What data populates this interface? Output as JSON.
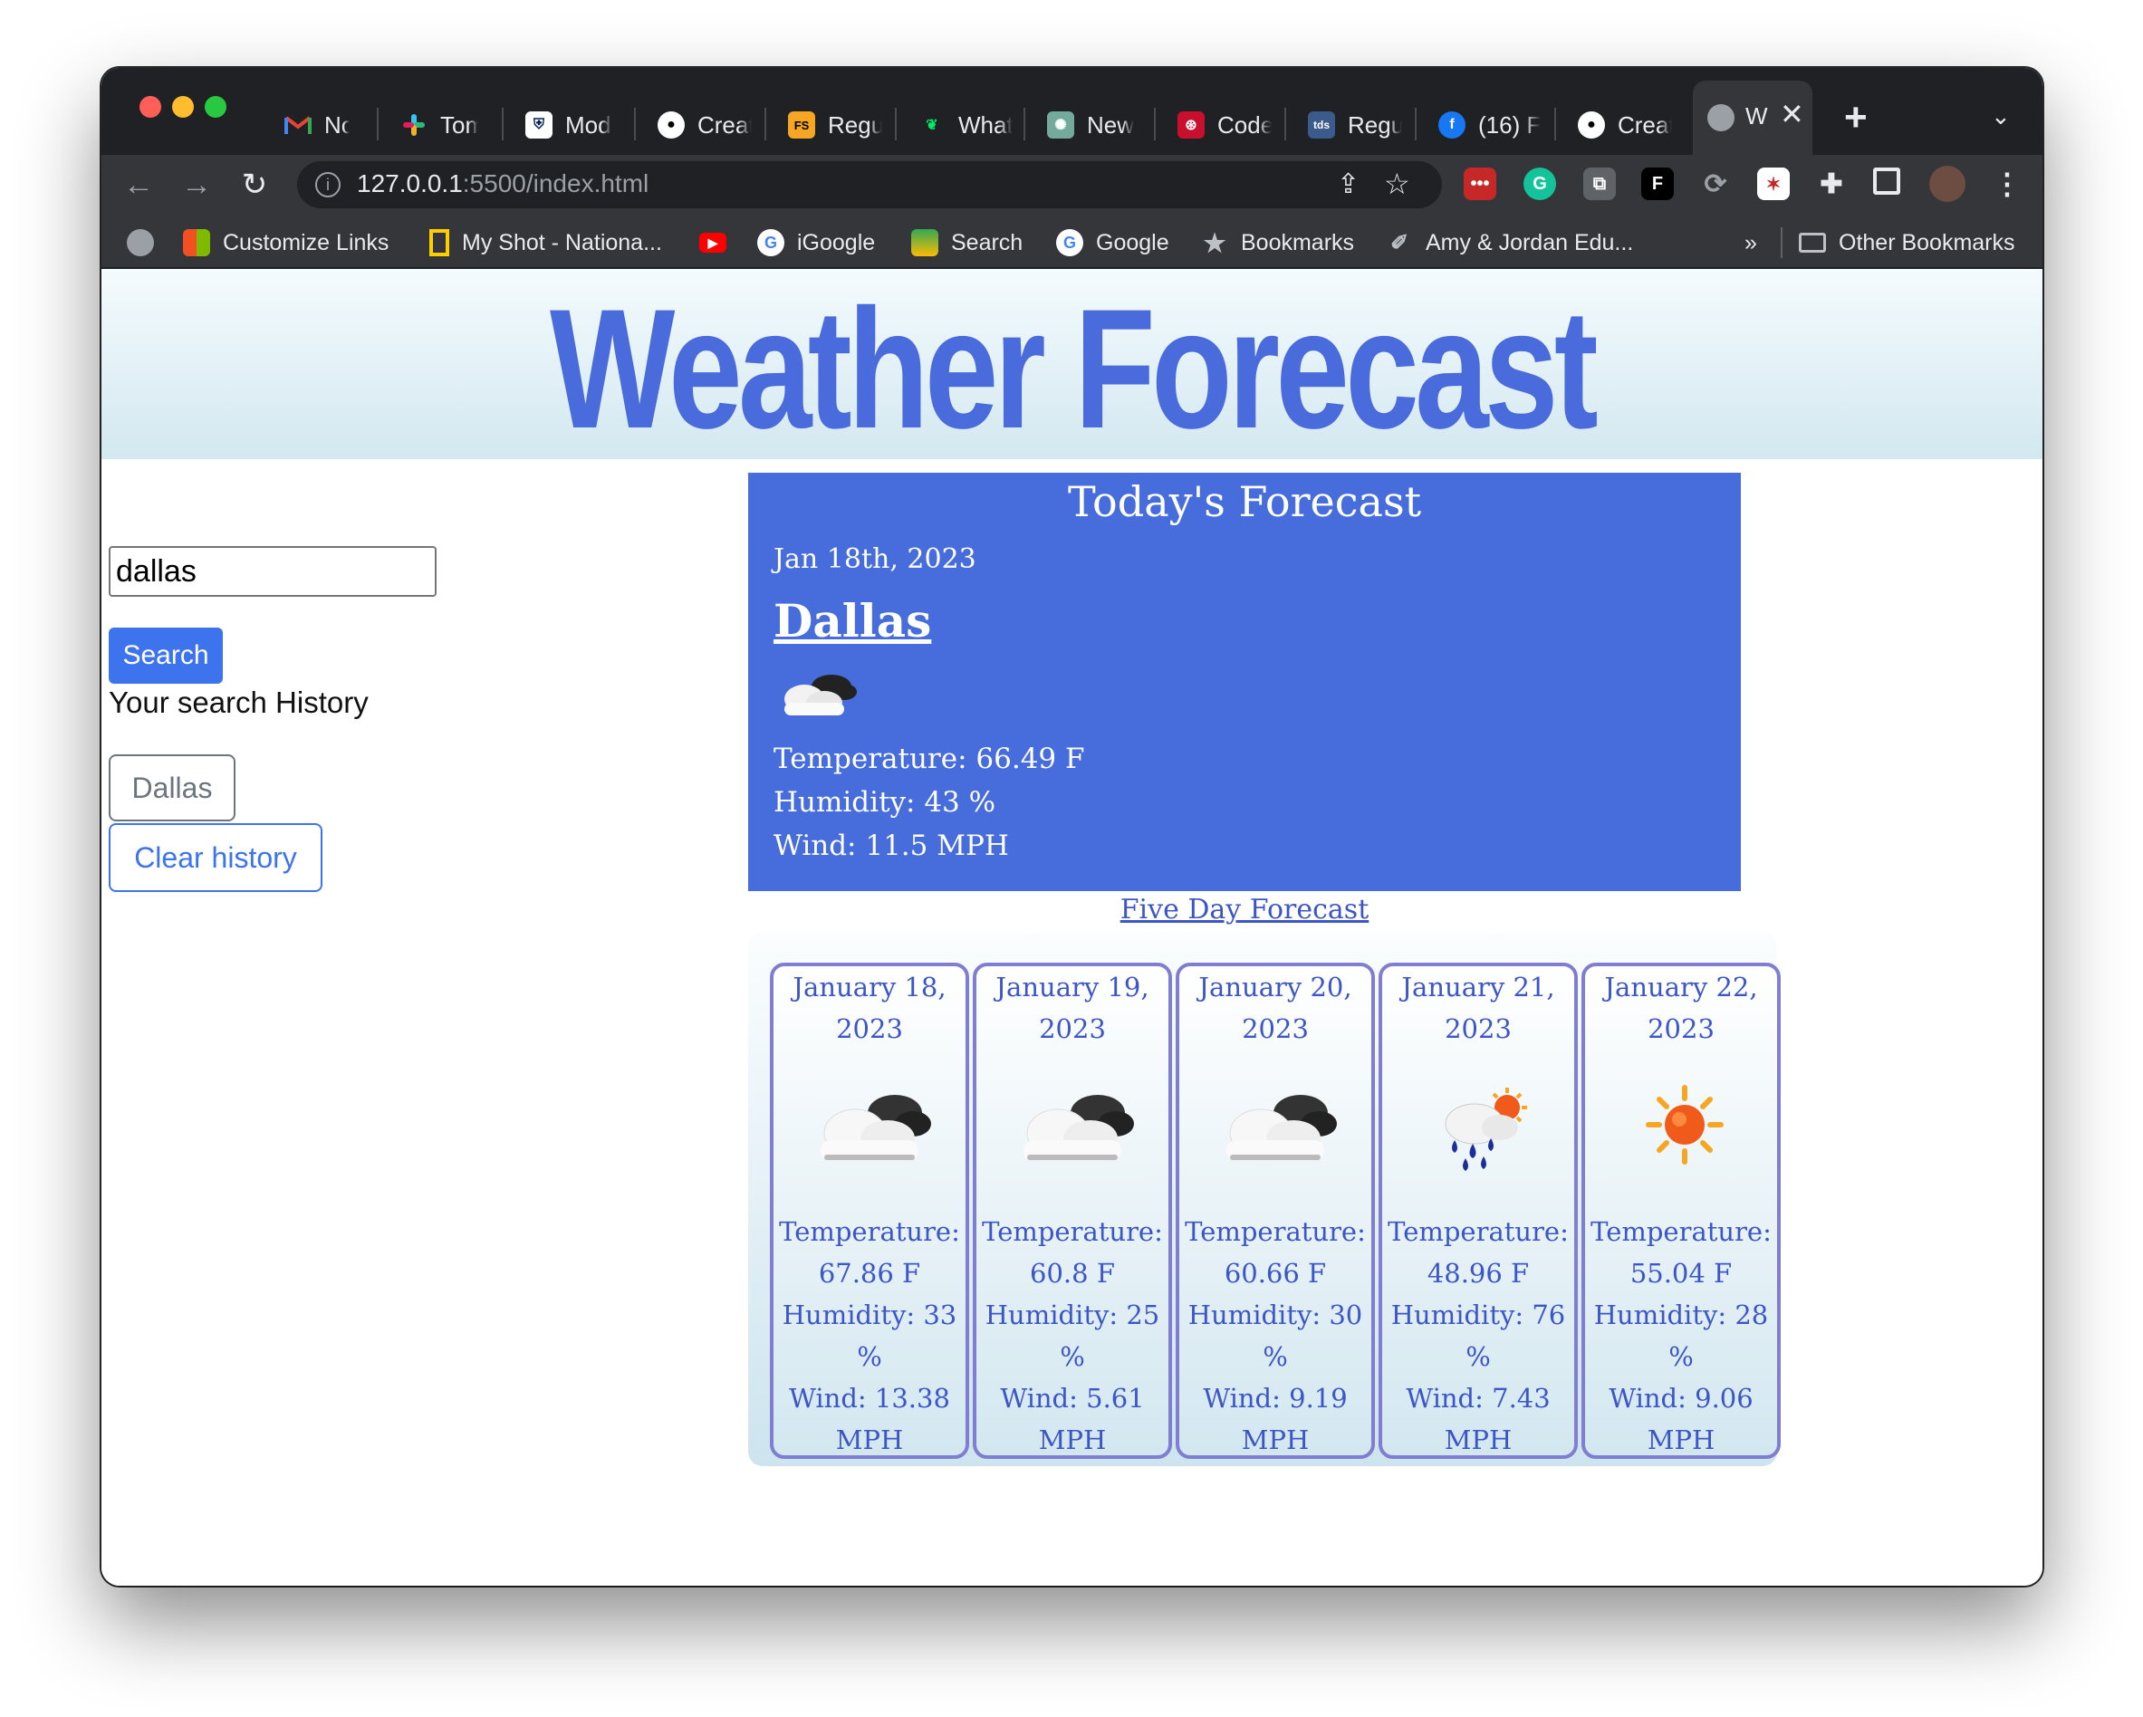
{
  "browser": {
    "tabs": [
      {
        "title": "Notifi",
        "icon": "gmail-icon"
      },
      {
        "title": "Tom V",
        "icon": "slack-icon"
      },
      {
        "title": "Modu",
        "icon": "penn-icon"
      },
      {
        "title": "Creat",
        "icon": "github-icon"
      },
      {
        "title": "Regul",
        "icon": "fs-icon",
        "icon_text": "FS"
      },
      {
        "title": "What",
        "icon": "mongodb-icon"
      },
      {
        "title": "New",
        "icon": "chatgpt-icon"
      },
      {
        "title": "Code",
        "icon": "codesignal-icon"
      },
      {
        "title": "Regul",
        "icon": "tds-icon",
        "icon_text": "tds"
      },
      {
        "title": "(16) F",
        "icon": "facebook-icon"
      },
      {
        "title": "Creat",
        "icon": "github-icon"
      }
    ],
    "active_tab": {
      "title": "W",
      "icon": "globe-icon"
    },
    "url_host": "127.0.0.1",
    "url_rest": ":5500/index.html",
    "bookmarks": [
      {
        "label": "",
        "icon": "globe-icon"
      },
      {
        "label": "Customize Links",
        "icon": "microsoft-icon"
      },
      {
        "label": "My Shot - Nationa...",
        "icon": "natgeo-icon"
      },
      {
        "label": "",
        "icon": "youtube-icon"
      },
      {
        "label": "iGoogle",
        "icon": "google-icon"
      },
      {
        "label": "Search",
        "icon": "search-app-icon"
      },
      {
        "label": "Google",
        "icon": "google-icon"
      },
      {
        "label": "Bookmarks",
        "icon": "star-icon"
      },
      {
        "label": "Amy & Jordan Edu...",
        "icon": "amy-jordan-icon"
      }
    ],
    "overflow_label": "»",
    "other_bookmarks": "Other Bookmarks"
  },
  "page": {
    "title": "Weather Forecast",
    "search_value": "dallas",
    "search_button": "Search",
    "history_label": "Your search History",
    "history_items": [
      "Dallas"
    ],
    "clear_button": "Clear history",
    "today": {
      "heading": "Today's Forecast",
      "date": "Jan 18th, 2023",
      "city": "Dallas",
      "icon": "partly-cloudy-icon",
      "temperature": "Temperature: 66.49 F",
      "humidity": "Humidity: 43 %",
      "wind": "Wind: 11.5 MPH"
    },
    "five_day_link": "Five Day Forecast",
    "forecast": [
      {
        "date": "January 18, 2023",
        "icon": "cloudy-icon",
        "temp": "Temperature: 67.86 F",
        "humidity": "Humidity: 33 %",
        "wind": "Wind: 13.38 MPH"
      },
      {
        "date": "January 19, 2023",
        "icon": "cloudy-icon",
        "temp": "Temperature: 60.8 F",
        "humidity": "Humidity: 25 %",
        "wind": "Wind: 5.61 MPH"
      },
      {
        "date": "January 20, 2023",
        "icon": "cloudy-icon",
        "temp": "Temperature: 60.66 F",
        "humidity": "Humidity: 30 %",
        "wind": "Wind: 9.19 MPH"
      },
      {
        "date": "January 21, 2023",
        "icon": "rain-sun-icon",
        "temp": "Temperature: 48.96 F",
        "humidity": "Humidity: 76 %",
        "wind": "Wind: 7.43 MPH"
      },
      {
        "date": "January 22, 2023",
        "icon": "sun-icon",
        "temp": "Temperature: 55.04 F",
        "humidity": "Humidity: 28 %",
        "wind": "Wind: 9.06 MPH"
      }
    ]
  },
  "colors": {
    "accent": "#466ddb",
    "title": "#4a6bdc",
    "button": "#3d74ee",
    "card_border": "#7f7ed0",
    "card_text": "#3c56c7"
  }
}
